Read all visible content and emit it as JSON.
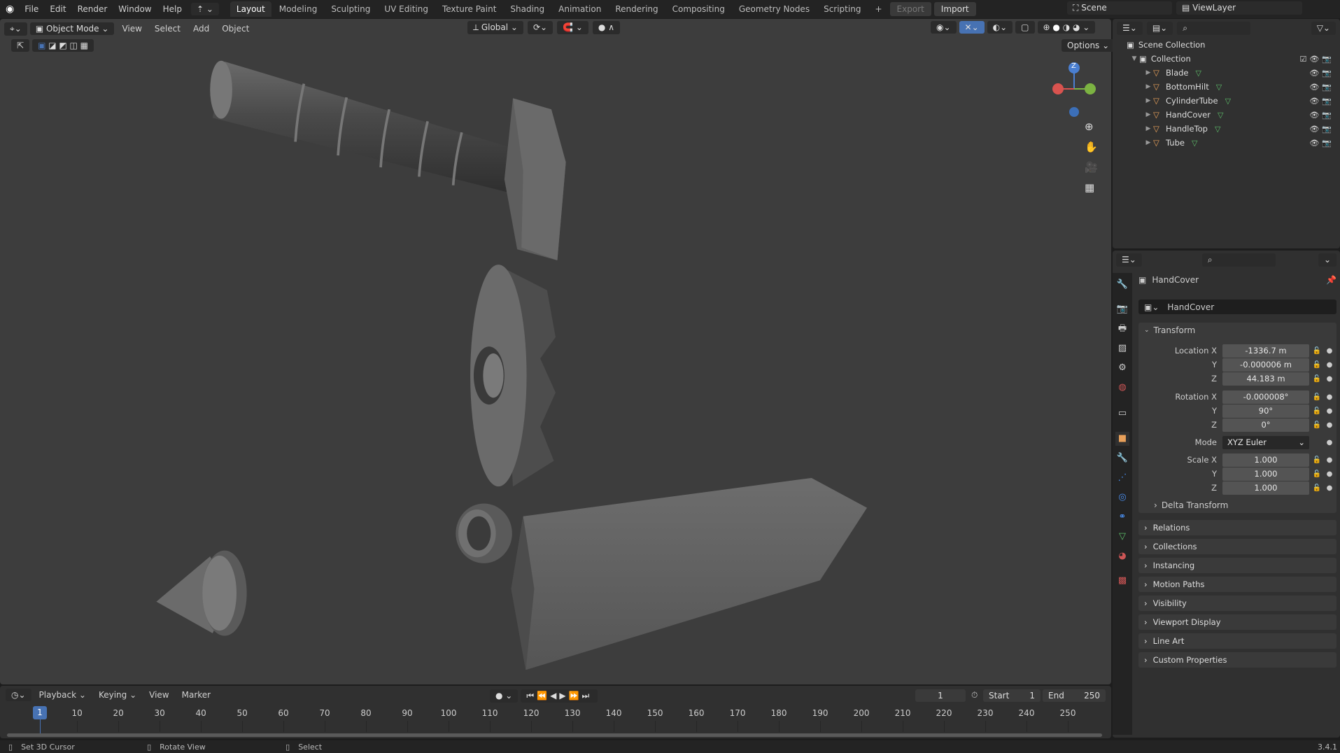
{
  "menu": [
    "File",
    "Edit",
    "Render",
    "Window",
    "Help"
  ],
  "workspaces": [
    "Layout",
    "Modeling",
    "Sculpting",
    "UV Editing",
    "Texture Paint",
    "Shading",
    "Animation",
    "Rendering",
    "Compositing",
    "Geometry Nodes",
    "Scripting"
  ],
  "export_label": "Export",
  "import_label": "Import",
  "scene": "Scene",
  "view_layer": "ViewLayer",
  "viewport": {
    "mode": "Object Mode",
    "menus": [
      "View",
      "Select",
      "Add",
      "Object"
    ],
    "orientation": "Global",
    "options": "Options",
    "gizmo": {
      "z": "Z"
    }
  },
  "outliner": {
    "root": "Scene Collection",
    "collection": "Collection",
    "objects": [
      "Blade",
      "BottomHilt",
      "CylinderTube",
      "HandCover",
      "HandleTop",
      "Tube"
    ]
  },
  "properties": {
    "object_name": "HandCover",
    "data_name": "HandCover",
    "transform_title": "Transform",
    "location": {
      "label": "Location X",
      "x": "-1336.7 m",
      "y": "-0.000006 m",
      "z": "44.183 m"
    },
    "rotation": {
      "label": "Rotation X",
      "x": "-0.000008°",
      "y": "90°",
      "z": "0°"
    },
    "mode_label": "Mode",
    "mode_value": "XYZ Euler",
    "scale": {
      "label": "Scale X",
      "x": "1.000",
      "y": "1.000",
      "z": "1.000"
    },
    "axis_y": "Y",
    "axis_z": "Z",
    "delta": "Delta Transform",
    "sections": [
      "Relations",
      "Collections",
      "Instancing",
      "Motion Paths",
      "Visibility",
      "Viewport Display",
      "Line Art",
      "Custom Properties"
    ]
  },
  "timeline": {
    "menus": [
      "Playback",
      "Keying",
      "View",
      "Marker"
    ],
    "current_frame": "1",
    "start_label": "Start",
    "start": "1",
    "end_label": "End",
    "end": "250",
    "ticks": [
      "10",
      "20",
      "30",
      "40",
      "50",
      "60",
      "70",
      "80",
      "90",
      "100",
      "110",
      "120",
      "130",
      "140",
      "150",
      "160",
      "170",
      "180",
      "190",
      "200",
      "210",
      "220",
      "230",
      "240",
      "250"
    ],
    "playhead": "1"
  },
  "status": {
    "left": "Set 3D Cursor",
    "middle": "Rotate View",
    "right": "Select",
    "version": "3.4.1"
  },
  "colors": {
    "accent": "#4772b3",
    "object": "#e8a05a",
    "mesh": "#5dbe6a"
  }
}
